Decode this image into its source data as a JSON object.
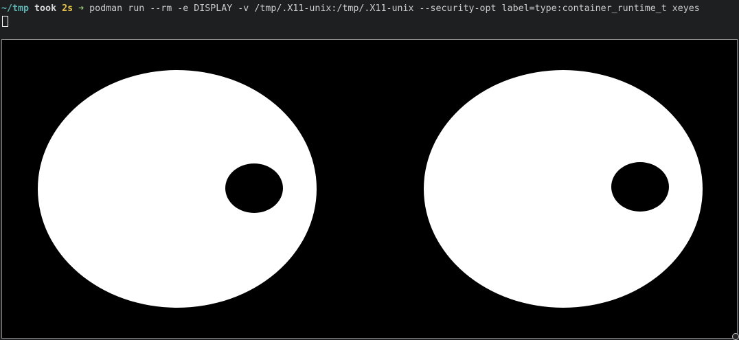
{
  "terminal": {
    "cwd": "~/tmp",
    "took_label": "took",
    "duration": "2s",
    "arrow": "➜",
    "command": "podman run --rm -e DISPLAY -v /tmp/.X11-unix:/tmp/.X11-unix --security-opt label=type:container_runtime_t xeyes"
  },
  "xeyes": {
    "eye_color": "#ffffff",
    "pupil_color": "#000000",
    "background": "#000000"
  }
}
